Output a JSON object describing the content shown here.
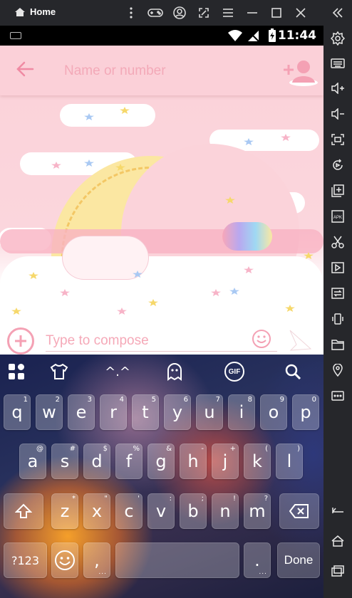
{
  "window": {
    "title": "Home"
  },
  "header": {
    "recipient_placeholder": "Name or number"
  },
  "status": {
    "time": "11:44"
  },
  "compose": {
    "placeholder": "Type to compose"
  },
  "keyboard": {
    "row1": [
      {
        "key": "q",
        "hint": "1"
      },
      {
        "key": "w",
        "hint": "2"
      },
      {
        "key": "e",
        "hint": "3"
      },
      {
        "key": "r",
        "hint": "4"
      },
      {
        "key": "t",
        "hint": "5"
      },
      {
        "key": "y",
        "hint": "6"
      },
      {
        "key": "u",
        "hint": "7"
      },
      {
        "key": "i",
        "hint": "8"
      },
      {
        "key": "o",
        "hint": "9"
      },
      {
        "key": "p",
        "hint": "0"
      }
    ],
    "row2": [
      {
        "key": "a",
        "hint": "@"
      },
      {
        "key": "s",
        "hint": "#"
      },
      {
        "key": "d",
        "hint": "$"
      },
      {
        "key": "f",
        "hint": "%"
      },
      {
        "key": "g",
        "hint": "&"
      },
      {
        "key": "h",
        "hint": "-"
      },
      {
        "key": "j",
        "hint": "+"
      },
      {
        "key": "k",
        "hint": "("
      },
      {
        "key": "l",
        "hint": ")"
      }
    ],
    "row3": [
      {
        "key": "z",
        "hint": "*"
      },
      {
        "key": "x",
        "hint": "\""
      },
      {
        "key": "c",
        "hint": "'"
      },
      {
        "key": "v",
        "hint": ":"
      },
      {
        "key": "b",
        "hint": ";"
      },
      {
        "key": "n",
        "hint": "!"
      },
      {
        "key": "m",
        "hint": "?"
      }
    ],
    "symbols_label": "?123",
    "comma": ",",
    "period": ".",
    "done_label": "Done",
    "gif_label": "GIF",
    "theme_label": "^.^"
  },
  "colors": {
    "accent_pink": "#f4a1b4",
    "title_bg": "#26272b"
  },
  "icons": [
    "home-icon",
    "gamepad-icon",
    "user-icon",
    "screenshot-icon",
    "menu-icon",
    "minimize-icon",
    "maximize-icon",
    "close-icon",
    "back-arrow-icon",
    "add-contact-icon",
    "emoji-icon",
    "send-icon",
    "apps-icon",
    "tshirt-icon",
    "ghost-icon",
    "search-icon",
    "shift-icon",
    "backspace-icon",
    "wifi-icon",
    "signal-icon",
    "battery-icon"
  ]
}
